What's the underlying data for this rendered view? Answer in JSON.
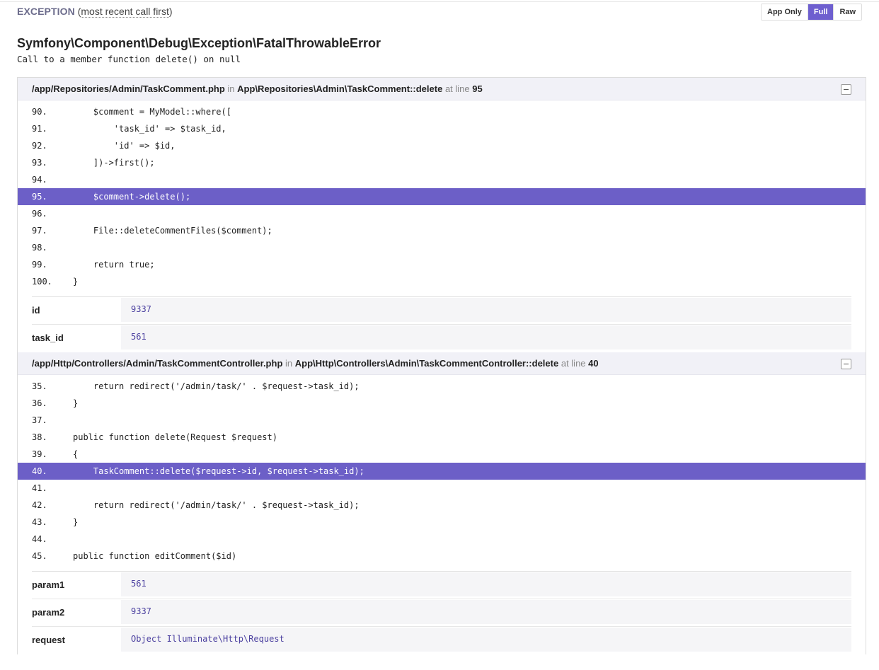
{
  "exception": {
    "label": "EXCEPTION",
    "open_paren": "(",
    "order": "most recent call first",
    "close_paren": ")",
    "class_name": "Symfony\\Component\\Debug\\Exception\\FatalThrowableError",
    "message": "Call to a member function delete() on null"
  },
  "view_toggle": {
    "app_only": "App Only",
    "full": "Full",
    "raw": "Raw",
    "active": "Full",
    "accent_color": "#6c5fc7"
  },
  "frames": [
    {
      "file": "/app/Repositories/Admin/TaskComment.php",
      "in_label": "in",
      "function": "App\\Repositories\\Admin\\TaskComment::delete",
      "at_line_label": "at line",
      "line": "95",
      "code": [
        {
          "n": "90.",
          "text": "    $comment = MyModel::where([",
          "hl": false
        },
        {
          "n": "91.",
          "text": "        'task_id' => $task_id,",
          "hl": false
        },
        {
          "n": "92.",
          "text": "        'id' => $id,",
          "hl": false
        },
        {
          "n": "93.",
          "text": "    ])->first();",
          "hl": false
        },
        {
          "n": "94.",
          "text": "",
          "hl": false
        },
        {
          "n": "95.",
          "text": "    $comment->delete();",
          "hl": true
        },
        {
          "n": "96.",
          "text": "",
          "hl": false
        },
        {
          "n": "97.",
          "text": "    File::deleteCommentFiles($comment);",
          "hl": false
        },
        {
          "n": "98.",
          "text": "",
          "hl": false
        },
        {
          "n": "99.",
          "text": "    return true;",
          "hl": false
        },
        {
          "n": "100.",
          "text": "}",
          "hl": false
        }
      ],
      "vars": [
        {
          "key": "id",
          "value": "9337"
        },
        {
          "key": "task_id",
          "value": "561"
        }
      ]
    },
    {
      "file": "/app/Http/Controllers/Admin/TaskCommentController.php",
      "in_label": "in",
      "function": "App\\Http\\Controllers\\Admin\\TaskCommentController::delete",
      "at_line_label": "at line",
      "line": "40",
      "code": [
        {
          "n": "35.",
          "text": "    return redirect('/admin/task/' . $request->task_id);",
          "hl": false
        },
        {
          "n": "36.",
          "text": "}",
          "hl": false
        },
        {
          "n": "37.",
          "text": "",
          "hl": false
        },
        {
          "n": "38.",
          "text": "public function delete(Request $request)",
          "hl": false
        },
        {
          "n": "39.",
          "text": "{",
          "hl": false
        },
        {
          "n": "40.",
          "text": "    TaskComment::delete($request->id, $request->task_id);",
          "hl": true
        },
        {
          "n": "41.",
          "text": "",
          "hl": false
        },
        {
          "n": "42.",
          "text": "    return redirect('/admin/task/' . $request->task_id);",
          "hl": false
        },
        {
          "n": "43.",
          "text": "}",
          "hl": false
        },
        {
          "n": "44.",
          "text": "",
          "hl": false
        },
        {
          "n": "45.",
          "text": "public function editComment($id)",
          "hl": false
        }
      ],
      "vars": [
        {
          "key": "param1",
          "value": "561"
        },
        {
          "key": "param2",
          "value": "9337"
        },
        {
          "key": "request",
          "value": "Object Illuminate\\Http\\Request"
        }
      ]
    }
  ]
}
